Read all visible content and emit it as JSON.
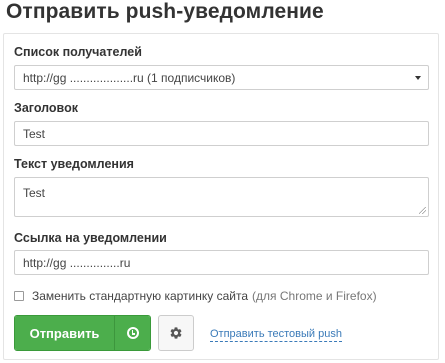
{
  "title": "Отправить push-уведомление",
  "recipients": {
    "label": "Список получателей",
    "selected": "http://gg ...................ru (1 подписчиков)"
  },
  "heading": {
    "label": "Заголовок",
    "value": "Test"
  },
  "body_text": {
    "label": "Текст уведомления",
    "value": "Test"
  },
  "link": {
    "label": "Ссылка на уведомлении",
    "value": "http://gg ...............ru"
  },
  "replace_image": {
    "label": "Заменить стандартную картинку сайта",
    "hint": "(для Chrome и Firefox)",
    "checked": false
  },
  "actions": {
    "send_label": "Отправить",
    "schedule_icon": "clock-icon",
    "settings_icon": "gear-icon",
    "test_link_label": "Отправить тестовый push"
  },
  "colors": {
    "primary_green": "#4cae4c",
    "link_blue": "#3a7ab8"
  }
}
